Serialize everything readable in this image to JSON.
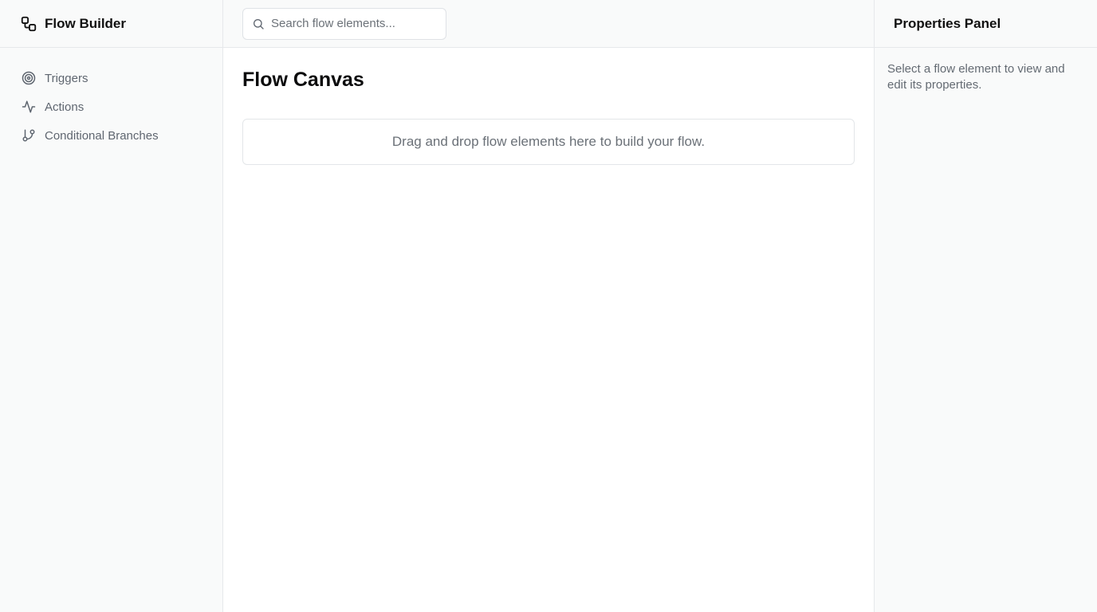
{
  "app": {
    "title": "Flow Builder",
    "logo_icon": "workflow-icon"
  },
  "sidebar": {
    "items": [
      {
        "label": "Triggers",
        "icon": "target-icon"
      },
      {
        "label": "Actions",
        "icon": "activity-icon"
      },
      {
        "label": "Conditional Branches",
        "icon": "git-branch-icon"
      }
    ]
  },
  "search": {
    "placeholder": "Search flow elements...",
    "value": "",
    "icon": "search-icon"
  },
  "canvas": {
    "title": "Flow Canvas",
    "dropzone_text": "Drag and drop flow elements here to build your flow."
  },
  "properties": {
    "title": "Properties Panel",
    "hint": "Select a flow element to view and edit its properties."
  },
  "colors": {
    "panel_bg": "#f9fafa",
    "border": "#e6e8eb",
    "muted_text": "#6b7178"
  }
}
